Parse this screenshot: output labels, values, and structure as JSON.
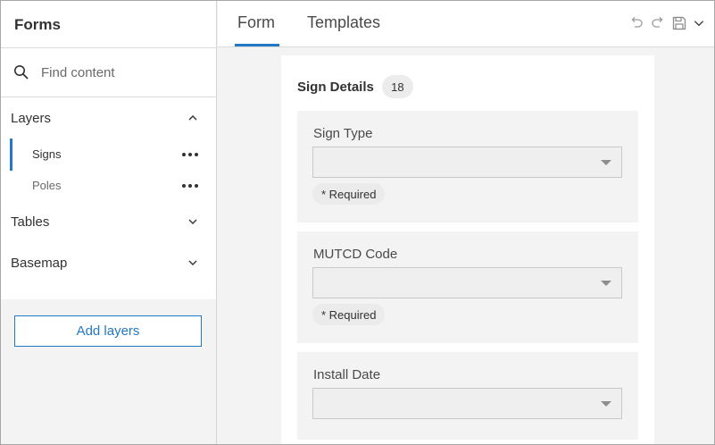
{
  "sidebar": {
    "title": "Forms",
    "search": {
      "placeholder": "Find content",
      "value": ""
    },
    "sections": {
      "layers": {
        "label": "Layers",
        "state": "expanded"
      },
      "tables": {
        "label": "Tables",
        "state": "collapsed"
      },
      "basemap": {
        "label": "Basemap",
        "state": "collapsed"
      }
    },
    "layers": [
      {
        "label": "Signs",
        "active": true
      },
      {
        "label": "Poles",
        "active": false
      }
    ],
    "add_layers_label": "Add layers"
  },
  "tabs": [
    {
      "label": "Form",
      "active": true
    },
    {
      "label": "Templates",
      "active": false
    }
  ],
  "toolbar": {
    "icons": [
      "undo-icon",
      "redo-icon",
      "save-icon",
      "chevron-down-icon"
    ]
  },
  "form": {
    "group_title": "Sign Details",
    "group_count": "18",
    "fields": [
      {
        "label": "Sign Type",
        "value": "",
        "required_label": "* Required"
      },
      {
        "label": "MUTCD Code",
        "value": "",
        "required_label": "* Required"
      },
      {
        "label": "Install Date",
        "value": ""
      }
    ]
  },
  "colors": {
    "accent": "#2479c4",
    "panel_bg": "#f3f3f3",
    "card_bg": "#ffffff"
  }
}
